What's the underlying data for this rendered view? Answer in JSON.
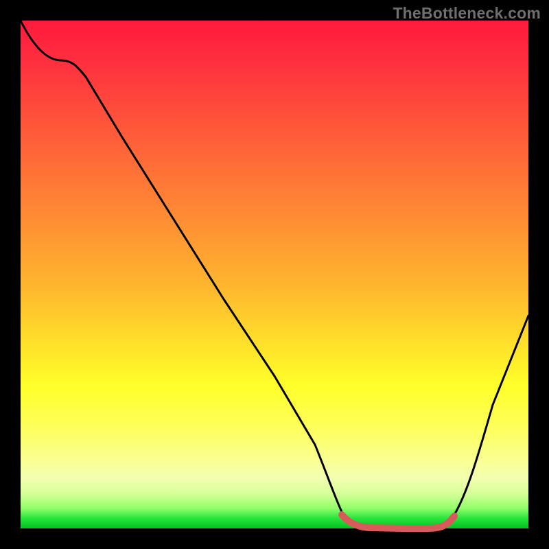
{
  "watermark": "TheBottleneck.com",
  "chart_data": {
    "type": "line",
    "title": "",
    "xlabel": "",
    "ylabel": "",
    "xlim": [
      0,
      100
    ],
    "ylim": [
      0,
      100
    ],
    "grid": false,
    "legend": false,
    "series": [
      {
        "name": "bottleneck-curve",
        "x": [
          0,
          5,
          8,
          12,
          20,
          30,
          40,
          50,
          58,
          63,
          68,
          75,
          80,
          85,
          90,
          95,
          100
        ],
        "values": [
          100,
          95,
          93,
          90,
          77,
          61,
          45,
          30,
          16,
          5,
          1,
          0,
          0,
          1,
          8,
          22,
          42
        ]
      }
    ],
    "highlight": {
      "name": "optimal-range",
      "x_start": 63,
      "x_end": 85,
      "color": "#d85a5a"
    },
    "gradient_stops": [
      {
        "pos": 0,
        "color": "#ff1a3c"
      },
      {
        "pos": 22,
        "color": "#ff5a3a"
      },
      {
        "pos": 52,
        "color": "#ffb52e"
      },
      {
        "pos": 72,
        "color": "#ffff2a"
      },
      {
        "pos": 90,
        "color": "#f4ffb0"
      },
      {
        "pos": 100,
        "color": "#00c221"
      }
    ]
  }
}
